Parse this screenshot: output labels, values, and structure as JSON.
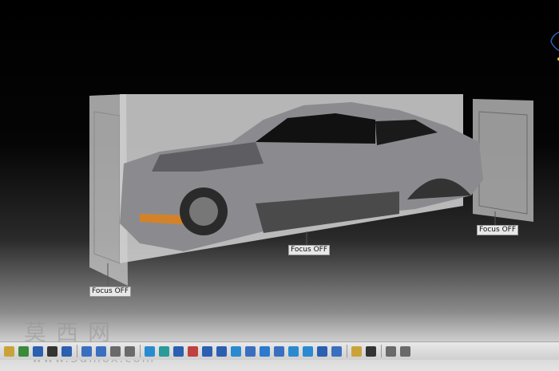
{
  "viewport": {
    "focus_labels": [
      "Focus OFF",
      "Focus OFF",
      "Focus OFF"
    ]
  },
  "watermark": {
    "text": "莫西网",
    "url": "www.3dmox.com"
  },
  "toolbar": {
    "buttons": [
      {
        "icon": "save-icon",
        "color": "#c9a33a"
      },
      {
        "icon": "undo-icon",
        "color": "#3a8a3a"
      },
      {
        "icon": "help-icon",
        "color": "#2c5fb0"
      },
      {
        "icon": "formula-icon",
        "color": "#333333"
      },
      {
        "icon": "comment-icon",
        "color": "#2c5fb0"
      },
      {
        "icon": "table-icon",
        "color": "#3a6fc0"
      },
      {
        "icon": "tree-icon",
        "color": "#3a6fc0"
      },
      {
        "icon": "catalog-icon",
        "color": "#6a6a6a"
      },
      {
        "icon": "list-icon",
        "color": "#6a6a6a"
      },
      {
        "icon": "fly-icon",
        "color": "#2a8ad0"
      },
      {
        "icon": "fit-all-icon",
        "color": "#2a9a9a"
      },
      {
        "icon": "pan-icon",
        "color": "#2c5fb0"
      },
      {
        "icon": "rotate-icon",
        "color": "#c04040"
      },
      {
        "icon": "zoom-in-icon",
        "color": "#2c5fb0"
      },
      {
        "icon": "zoom-out-icon",
        "color": "#2c5fb0"
      },
      {
        "icon": "normal-view-icon",
        "color": "#2a8ad0"
      },
      {
        "icon": "quick-view-icon",
        "color": "#3a6fc0"
      },
      {
        "icon": "view-mode-icon",
        "color": "#2a7ad0"
      },
      {
        "icon": "hide-show-icon",
        "color": "#3a6fc0"
      },
      {
        "icon": "swap-space-icon",
        "color": "#2a8ad0"
      },
      {
        "icon": "measure-icon",
        "color": "#2a8ad0"
      },
      {
        "icon": "apply-material-icon",
        "color": "#2c5fb0"
      },
      {
        "icon": "snapshot-icon",
        "color": "#3a6fc0"
      },
      {
        "icon": "bottle-icon",
        "color": "#c9a33a"
      },
      {
        "icon": "camera-icon",
        "color": "#333333"
      },
      {
        "icon": "split-view-icon",
        "color": "#6a6a6a"
      },
      {
        "icon": "window-icon",
        "color": "#6a6a6a"
      }
    ]
  }
}
